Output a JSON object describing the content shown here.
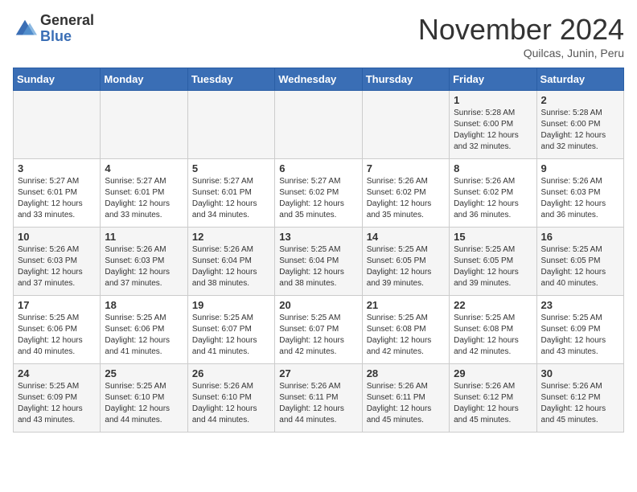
{
  "header": {
    "logo": {
      "general": "General",
      "blue": "Blue"
    },
    "title": "November 2024",
    "subtitle": "Quilcas, Junin, Peru"
  },
  "days_of_week": [
    "Sunday",
    "Monday",
    "Tuesday",
    "Wednesday",
    "Thursday",
    "Friday",
    "Saturday"
  ],
  "weeks": [
    [
      {
        "day": "",
        "info": ""
      },
      {
        "day": "",
        "info": ""
      },
      {
        "day": "",
        "info": ""
      },
      {
        "day": "",
        "info": ""
      },
      {
        "day": "",
        "info": ""
      },
      {
        "day": "1",
        "info": "Sunrise: 5:28 AM\nSunset: 6:00 PM\nDaylight: 12 hours and 32 minutes."
      },
      {
        "day": "2",
        "info": "Sunrise: 5:28 AM\nSunset: 6:00 PM\nDaylight: 12 hours and 32 minutes."
      }
    ],
    [
      {
        "day": "3",
        "info": "Sunrise: 5:27 AM\nSunset: 6:01 PM\nDaylight: 12 hours and 33 minutes."
      },
      {
        "day": "4",
        "info": "Sunrise: 5:27 AM\nSunset: 6:01 PM\nDaylight: 12 hours and 33 minutes."
      },
      {
        "day": "5",
        "info": "Sunrise: 5:27 AM\nSunset: 6:01 PM\nDaylight: 12 hours and 34 minutes."
      },
      {
        "day": "6",
        "info": "Sunrise: 5:27 AM\nSunset: 6:02 PM\nDaylight: 12 hours and 35 minutes."
      },
      {
        "day": "7",
        "info": "Sunrise: 5:26 AM\nSunset: 6:02 PM\nDaylight: 12 hours and 35 minutes."
      },
      {
        "day": "8",
        "info": "Sunrise: 5:26 AM\nSunset: 6:02 PM\nDaylight: 12 hours and 36 minutes."
      },
      {
        "day": "9",
        "info": "Sunrise: 5:26 AM\nSunset: 6:03 PM\nDaylight: 12 hours and 36 minutes."
      }
    ],
    [
      {
        "day": "10",
        "info": "Sunrise: 5:26 AM\nSunset: 6:03 PM\nDaylight: 12 hours and 37 minutes."
      },
      {
        "day": "11",
        "info": "Sunrise: 5:26 AM\nSunset: 6:03 PM\nDaylight: 12 hours and 37 minutes."
      },
      {
        "day": "12",
        "info": "Sunrise: 5:26 AM\nSunset: 6:04 PM\nDaylight: 12 hours and 38 minutes."
      },
      {
        "day": "13",
        "info": "Sunrise: 5:25 AM\nSunset: 6:04 PM\nDaylight: 12 hours and 38 minutes."
      },
      {
        "day": "14",
        "info": "Sunrise: 5:25 AM\nSunset: 6:05 PM\nDaylight: 12 hours and 39 minutes."
      },
      {
        "day": "15",
        "info": "Sunrise: 5:25 AM\nSunset: 6:05 PM\nDaylight: 12 hours and 39 minutes."
      },
      {
        "day": "16",
        "info": "Sunrise: 5:25 AM\nSunset: 6:05 PM\nDaylight: 12 hours and 40 minutes."
      }
    ],
    [
      {
        "day": "17",
        "info": "Sunrise: 5:25 AM\nSunset: 6:06 PM\nDaylight: 12 hours and 40 minutes."
      },
      {
        "day": "18",
        "info": "Sunrise: 5:25 AM\nSunset: 6:06 PM\nDaylight: 12 hours and 41 minutes."
      },
      {
        "day": "19",
        "info": "Sunrise: 5:25 AM\nSunset: 6:07 PM\nDaylight: 12 hours and 41 minutes."
      },
      {
        "day": "20",
        "info": "Sunrise: 5:25 AM\nSunset: 6:07 PM\nDaylight: 12 hours and 42 minutes."
      },
      {
        "day": "21",
        "info": "Sunrise: 5:25 AM\nSunset: 6:08 PM\nDaylight: 12 hours and 42 minutes."
      },
      {
        "day": "22",
        "info": "Sunrise: 5:25 AM\nSunset: 6:08 PM\nDaylight: 12 hours and 42 minutes."
      },
      {
        "day": "23",
        "info": "Sunrise: 5:25 AM\nSunset: 6:09 PM\nDaylight: 12 hours and 43 minutes."
      }
    ],
    [
      {
        "day": "24",
        "info": "Sunrise: 5:25 AM\nSunset: 6:09 PM\nDaylight: 12 hours and 43 minutes."
      },
      {
        "day": "25",
        "info": "Sunrise: 5:25 AM\nSunset: 6:10 PM\nDaylight: 12 hours and 44 minutes."
      },
      {
        "day": "26",
        "info": "Sunrise: 5:26 AM\nSunset: 6:10 PM\nDaylight: 12 hours and 44 minutes."
      },
      {
        "day": "27",
        "info": "Sunrise: 5:26 AM\nSunset: 6:11 PM\nDaylight: 12 hours and 44 minutes."
      },
      {
        "day": "28",
        "info": "Sunrise: 5:26 AM\nSunset: 6:11 PM\nDaylight: 12 hours and 45 minutes."
      },
      {
        "day": "29",
        "info": "Sunrise: 5:26 AM\nSunset: 6:12 PM\nDaylight: 12 hours and 45 minutes."
      },
      {
        "day": "30",
        "info": "Sunrise: 5:26 AM\nSunset: 6:12 PM\nDaylight: 12 hours and 45 minutes."
      }
    ]
  ]
}
